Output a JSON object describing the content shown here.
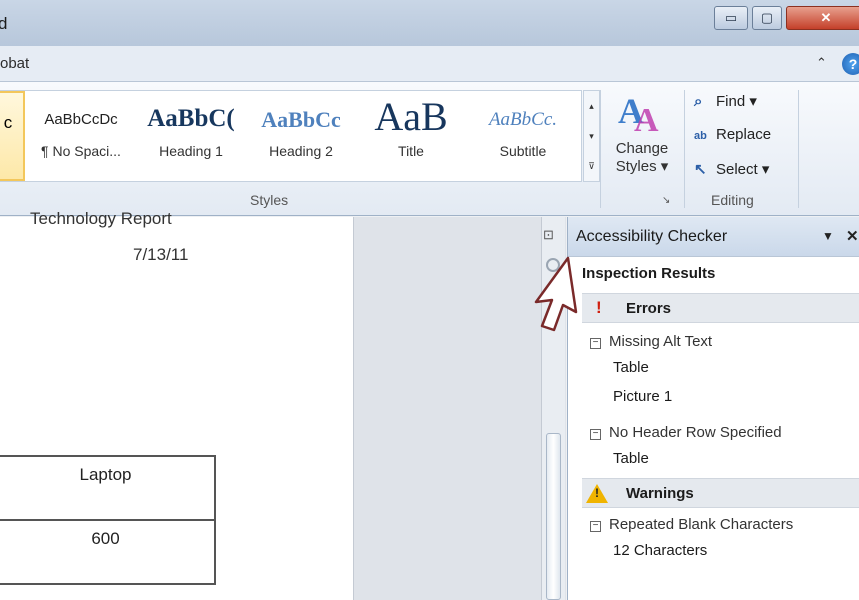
{
  "window": {
    "title": "d",
    "buttons": {
      "minimize": "▭",
      "maximize": "▢",
      "close": "✕"
    }
  },
  "tabs": {
    "partial_label": "obat",
    "collapse": "⌃",
    "help": "?"
  },
  "ribbon": {
    "styles_gallery": [
      {
        "preview": "c",
        "label": "",
        "color": "#1f3864",
        "selected": true
      },
      {
        "preview": "AaBbCcDc",
        "label": "¶ No Spaci...",
        "color": "#222222"
      },
      {
        "preview": "AaBbC(",
        "label": "Heading 1",
        "color": "#17375e"
      },
      {
        "preview": "AaBbCc",
        "label": "Heading 2",
        "color": "#4f81bd"
      },
      {
        "preview": "AaB",
        "label": "Title",
        "color": "#17365d"
      },
      {
        "preview": "AaBbCc.",
        "label": "Subtitle",
        "color": "#4f81bd"
      }
    ],
    "styles_group_label": "Styles",
    "change_styles": {
      "line1": "Change",
      "line2": "Styles ▾"
    },
    "editing": {
      "find": "Find ▾",
      "replace": "Replace",
      "select": "Select ▾",
      "group_label": "Editing"
    }
  },
  "document": {
    "heading": "Technology Report",
    "date": "7/13/11",
    "table": [
      [
        "Laptop"
      ],
      [
        "600"
      ]
    ]
  },
  "accessibility_pane": {
    "title": "Accessibility Checker",
    "dropdown": "▼",
    "close": "✕",
    "inspection_results": "Inspection Results",
    "errors_label": "Errors",
    "warnings_label": "Warnings",
    "errors": [
      {
        "title": "Missing Alt Text",
        "items": [
          "Table",
          "Picture 1"
        ]
      },
      {
        "title": "No Header Row Specified",
        "items": [
          "Table"
        ]
      }
    ],
    "warnings": [
      {
        "title": "Repeated Blank Characters",
        "items": [
          "12 Characters"
        ]
      }
    ]
  }
}
